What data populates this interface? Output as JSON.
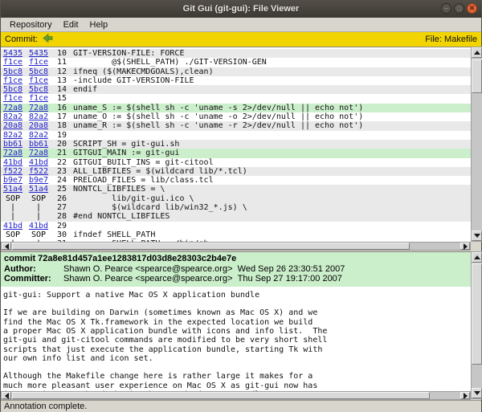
{
  "window": {
    "title": "Git Gui (git-gui): File Viewer"
  },
  "menu": {
    "items": [
      "Repository",
      "Edit",
      "Help"
    ]
  },
  "commit_bar": {
    "label": "Commit:",
    "file_label": "File: Makefile"
  },
  "colors": {
    "titlebar": "#3c3933",
    "menu_bg": "#d8d5cd",
    "commit_bar_bg": "#f2d400",
    "selected_line_bg": "#cbeecb",
    "alt_line_bg": "#e9e9e9",
    "link_blue": "#2323cc",
    "close_button": "#e2653a",
    "back_icon_green": "#6a9f2f"
  },
  "blame": {
    "lines": [
      {
        "c1": "5435",
        "c2": "5435",
        "link": true,
        "num": "10",
        "code": "GIT-VERSION-FILE: FORCE",
        "bg": "gray"
      },
      {
        "c1": "f1ce",
        "c2": "f1ce",
        "link": true,
        "num": "11",
        "code": "        @$(SHELL_PATH) ./GIT-VERSION-GEN",
        "bg": "white"
      },
      {
        "c1": "5bc8",
        "c2": "5bc8",
        "link": true,
        "num": "12",
        "code": "ifneq ($(MAKECMDGOALS),clean)",
        "bg": "gray"
      },
      {
        "c1": "f1ce",
        "c2": "f1ce",
        "link": true,
        "num": "13",
        "code": "-include GIT-VERSION-FILE",
        "bg": "white"
      },
      {
        "c1": "5bc8",
        "c2": "5bc8",
        "link": true,
        "num": "14",
        "code": "endif",
        "bg": "gray"
      },
      {
        "c1": "f1ce",
        "c2": "f1ce",
        "link": true,
        "num": "15",
        "code": "",
        "bg": "white"
      },
      {
        "c1": "72a8",
        "c2": "72a8",
        "link": true,
        "num": "16",
        "code": "uname_S := $(shell sh -c 'uname -s 2>/dev/null || echo not')",
        "bg": "green"
      },
      {
        "c1": "82a2",
        "c2": "82a2",
        "link": true,
        "num": "17",
        "code": "uname_O := $(shell sh -c 'uname -o 2>/dev/null || echo not')",
        "bg": "white"
      },
      {
        "c1": "20a8",
        "c2": "20a8",
        "link": true,
        "num": "18",
        "code": "uname_R := $(shell sh -c 'uname -r 2>/dev/null || echo not')",
        "bg": "gray"
      },
      {
        "c1": "82a2",
        "c2": "82a2",
        "link": true,
        "num": "19",
        "code": "",
        "bg": "white"
      },
      {
        "c1": "bb61",
        "c2": "bb61",
        "link": true,
        "num": "20",
        "code": "SCRIPT_SH = git-gui.sh",
        "bg": "gray"
      },
      {
        "c1": "72a8",
        "c2": "72a8",
        "link": true,
        "num": "21",
        "code": "GITGUI_MAIN := git-gui",
        "bg": "green"
      },
      {
        "c1": "41bd",
        "c2": "41bd",
        "link": true,
        "num": "22",
        "code": "GITGUI_BUILT_INS = git-citool",
        "bg": "white"
      },
      {
        "c1": "f522",
        "c2": "f522",
        "link": true,
        "num": "23",
        "code": "ALL_LIBFILES = $(wildcard lib/*.tcl)",
        "bg": "gray"
      },
      {
        "c1": "b9e7",
        "c2": "b9e7",
        "link": true,
        "num": "24",
        "code": "PRELOAD_FILES = lib/class.tcl",
        "bg": "white"
      },
      {
        "c1": "51a4",
        "c2": "51a4",
        "link": true,
        "num": "25",
        "code": "NONTCL_LIBFILES = \\",
        "bg": "gray"
      },
      {
        "c1": "SOP",
        "c2": "SOP",
        "link": false,
        "num": "26",
        "code": "        lib/git-gui.ico \\",
        "bg": "gray"
      },
      {
        "c1": "|",
        "c2": "|",
        "link": false,
        "num": "27",
        "code": "        $(wildcard lib/win32_*.js) \\",
        "bg": "gray"
      },
      {
        "c1": "|",
        "c2": "|",
        "link": false,
        "num": "28",
        "code": "#end NONTCL_LIBFILES",
        "bg": "gray"
      },
      {
        "c1": "41bd",
        "c2": "41bd",
        "link": true,
        "num": "29",
        "code": "",
        "bg": "white"
      },
      {
        "c1": "SOP",
        "c2": "SOP",
        "link": false,
        "num": "30",
        "code": "ifndef SHELL_PATH",
        "bg": "white"
      },
      {
        "c1": "|",
        "c2": "|",
        "link": false,
        "num": "31",
        "code": "        SHELL_PATH = /bin/sh",
        "bg": "white"
      }
    ]
  },
  "commit": {
    "commit_line": "commit 72a8e81d457a1ee1283817d03d8e28303c2b4e7e",
    "author_label": "Author:",
    "author": "Shawn O. Pearce <spearce@spearce.org>",
    "author_date": "Wed Sep 26 23:30:51 2007",
    "committer_label": "Committer:",
    "committer": "Shawn O. Pearce <spearce@spearce.org>",
    "committer_date": "Thu Sep 27 19:17:00 2007",
    "message": [
      "git-gui: Support a native Mac OS X application bundle",
      "",
      "If we are building on Darwin (sometimes known as Mac OS X) and we",
      "find the Mac OS X Tk.framework in the expected location we build",
      "a proper Mac OS X application bundle with icons and info list.  The",
      "git-gui and git-citool commands are modified to be very short shell",
      "scripts that just execute the application bundle, starting Tk with",
      "our own info list and icon set.",
      "",
      "Although the Makefile change here is rather large it makes for a",
      "much more pleasant user experience on Mac OS X as git-gui now has",
      "its own icon on the dock, in the standard ... Regardless"
    ]
  },
  "status_bar": {
    "text": "Annotation complete."
  }
}
